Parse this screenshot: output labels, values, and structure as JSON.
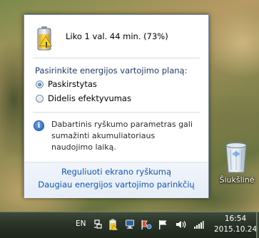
{
  "battery": {
    "status": "Liko 1 val. 44 min. (73%)",
    "percent": 73
  },
  "plans": {
    "heading": "Pasirinkite energijos vartojimo planą:",
    "options": [
      {
        "label": "Paskirstytas",
        "selected": true
      },
      {
        "label": "Didelis efektyvumas",
        "selected": false
      }
    ]
  },
  "info": {
    "text": "Dabartinis ryškumo parametras gali sumažinti akumuliatoriaus naudojimo laiką."
  },
  "links": {
    "brightness": "Reguliuoti ekrano ryškumą",
    "more_options": "Daugiau energijos vartojimo parinkčių"
  },
  "desktop": {
    "recycle_bin_label": "Šiukšlinė"
  },
  "taskbar": {
    "language": "EN",
    "time": "16:54",
    "date": "2015.10.24"
  },
  "colors": {
    "link": "#0e56b4",
    "heading": "#1e3a66",
    "battery_fill": "#f2c02b"
  }
}
